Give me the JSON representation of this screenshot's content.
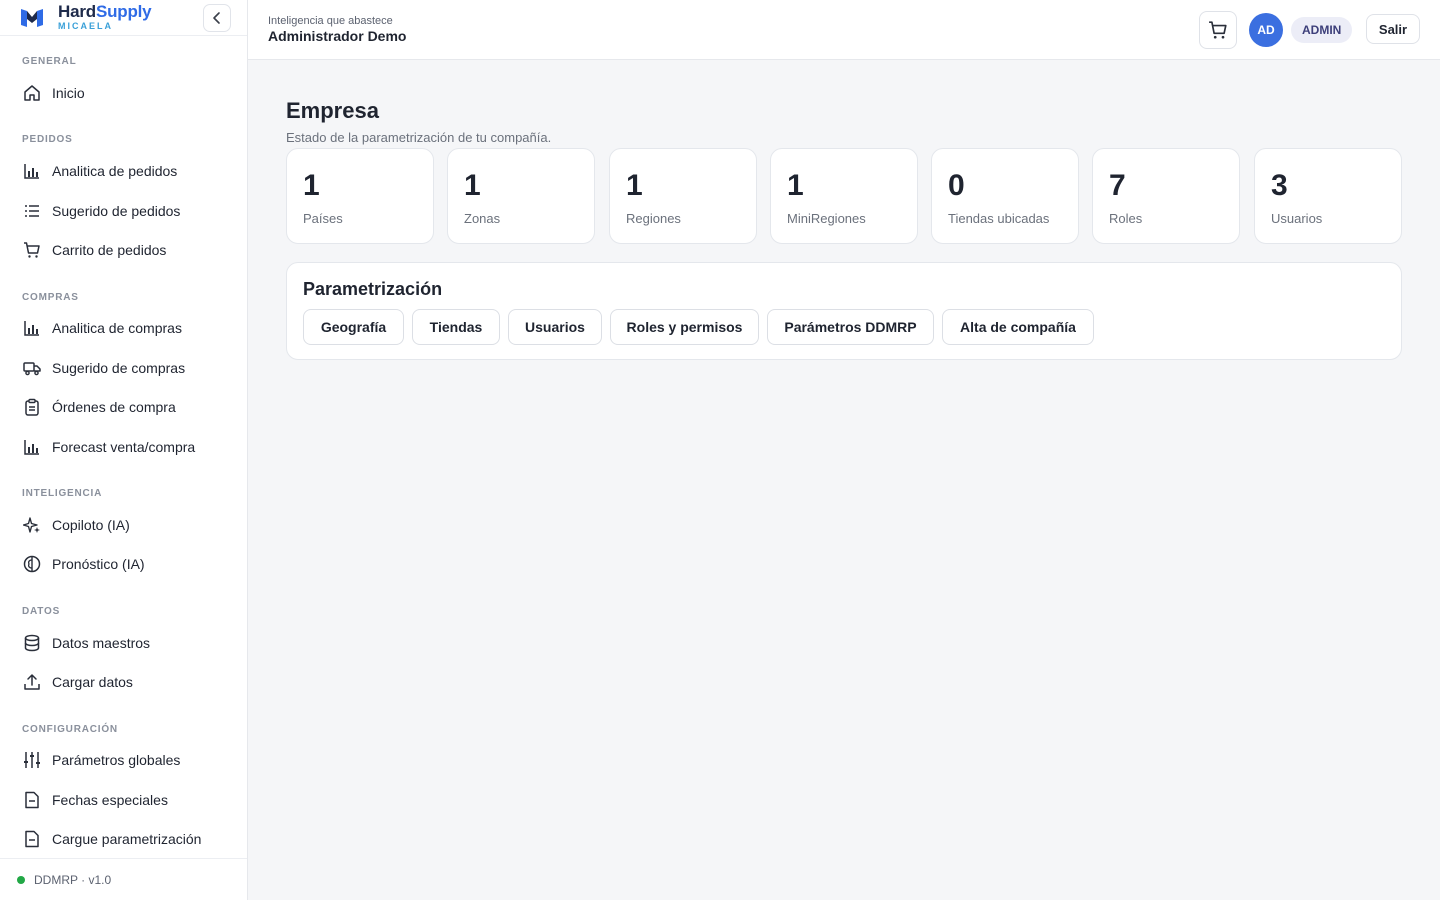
{
  "brand": {
    "name_part1": "Hard",
    "name_part2": "Supply",
    "subtitle": "MICAELA"
  },
  "sidebar": {
    "sections": [
      {
        "title": "GENERAL",
        "items": [
          {
            "label": "Inicio",
            "icon": "home-icon"
          }
        ]
      },
      {
        "title": "PEDIDOS",
        "items": [
          {
            "label": "Analitica de pedidos",
            "icon": "bar-chart-icon"
          },
          {
            "label": "Sugerido de pedidos",
            "icon": "list-icon"
          },
          {
            "label": "Carrito de pedidos",
            "icon": "cart-icon"
          }
        ]
      },
      {
        "title": "COMPRAS",
        "items": [
          {
            "label": "Analitica de compras",
            "icon": "bar-chart-icon"
          },
          {
            "label": "Sugerido de compras",
            "icon": "truck-icon"
          },
          {
            "label": "Órdenes de compra",
            "icon": "clipboard-icon"
          },
          {
            "label": "Forecast venta/compra",
            "icon": "bar-chart-icon"
          }
        ]
      },
      {
        "title": "INTELIGENCIA",
        "items": [
          {
            "label": "Copiloto (IA)",
            "icon": "sparkles-icon"
          },
          {
            "label": "Pronóstico (IA)",
            "icon": "brain-icon"
          }
        ]
      },
      {
        "title": "DATOS",
        "items": [
          {
            "label": "Datos maestros",
            "icon": "database-icon"
          },
          {
            "label": "Cargar datos",
            "icon": "upload-icon"
          }
        ]
      },
      {
        "title": "CONFIGURACIÓN",
        "items": [
          {
            "label": "Parámetros globales",
            "icon": "sliders-icon"
          },
          {
            "label": "Fechas especiales",
            "icon": "file-icon"
          },
          {
            "label": "Cargue parametrización",
            "icon": "file-icon"
          }
        ]
      }
    ],
    "footer": "DDMRP · v1.0"
  },
  "topbar": {
    "subtitle": "Inteligencia que abastece",
    "title": "Administrador Demo",
    "avatar_initials": "AD",
    "role": "ADMIN",
    "logout_label": "Salir"
  },
  "main": {
    "title": "Empresa",
    "subtitle": "Estado de la parametrización de tu compañía.",
    "stats": [
      {
        "value": "1",
        "label": "Países"
      },
      {
        "value": "1",
        "label": "Zonas"
      },
      {
        "value": "1",
        "label": "Regiones"
      },
      {
        "value": "1",
        "label": "MiniRegiones"
      },
      {
        "value": "0",
        "label": "Tiendas ubicadas"
      },
      {
        "value": "7",
        "label": "Roles"
      },
      {
        "value": "3",
        "label": "Usuarios"
      }
    ],
    "param": {
      "title": "Parametrización",
      "buttons": [
        "Geografía",
        "Tiendas",
        "Usuarios",
        "Roles y permisos",
        "Parámetros DDMRP",
        "Alta de compañía"
      ]
    }
  },
  "colors": {
    "accent": "#2f6be6",
    "avatar": "#3b6fe0",
    "status": "#22a846"
  }
}
